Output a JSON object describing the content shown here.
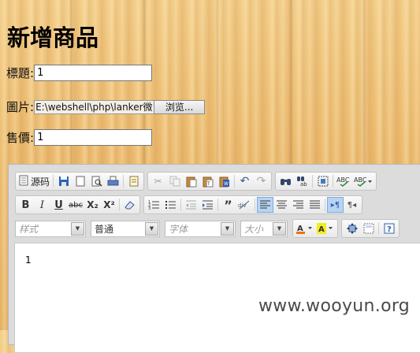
{
  "page": {
    "title": "新增商品"
  },
  "form": {
    "title_label": "標題:",
    "title_value": "1",
    "image_label": "圖片:",
    "image_path": "E:\\webshell\\php\\lanker微",
    "browse_label": "浏览...",
    "price_label": "售價:",
    "price_value": "1"
  },
  "editor": {
    "toolbar_row1": {
      "source_label": "源码",
      "icons": [
        "source-doc-icon",
        "save-icon",
        "new-page-icon",
        "preview-icon",
        "print-icon",
        "templates-icon",
        "cut-icon",
        "copy-icon",
        "paste-icon",
        "paste-text-icon",
        "paste-word-icon",
        "undo-icon",
        "redo-icon",
        "find-icon",
        "replace-icon",
        "select-all-icon",
        "spellcheck-icon",
        "spellcheck-dropdown-icon"
      ]
    },
    "toolbar_row2": {
      "bold": "B",
      "italic": "I",
      "underline": "U",
      "strike": "abc",
      "subscript": "X₂",
      "superscript": "X²",
      "icons": [
        "remove-format-icon",
        "numbered-list-icon",
        "bulleted-list-icon",
        "outdent-icon",
        "indent-icon",
        "blockquote-icon",
        "div-icon",
        "align-left-icon",
        "align-center-icon",
        "align-right-icon",
        "justify-icon",
        "ltr-icon",
        "rtl-icon"
      ]
    },
    "toolbar_row3": {
      "style_placeholder": "样式",
      "format_value": "普通",
      "font_placeholder": "字体",
      "size_placeholder": "大小",
      "icons": [
        "text-color-icon",
        "bg-color-icon",
        "maximize-icon",
        "show-blocks-icon",
        "about-icon"
      ]
    },
    "content_text": "1"
  },
  "watermark": "www.wooyun.org",
  "colors": {
    "active_button": "#b9d4f3",
    "editor_bg": "#dcdcdc"
  }
}
